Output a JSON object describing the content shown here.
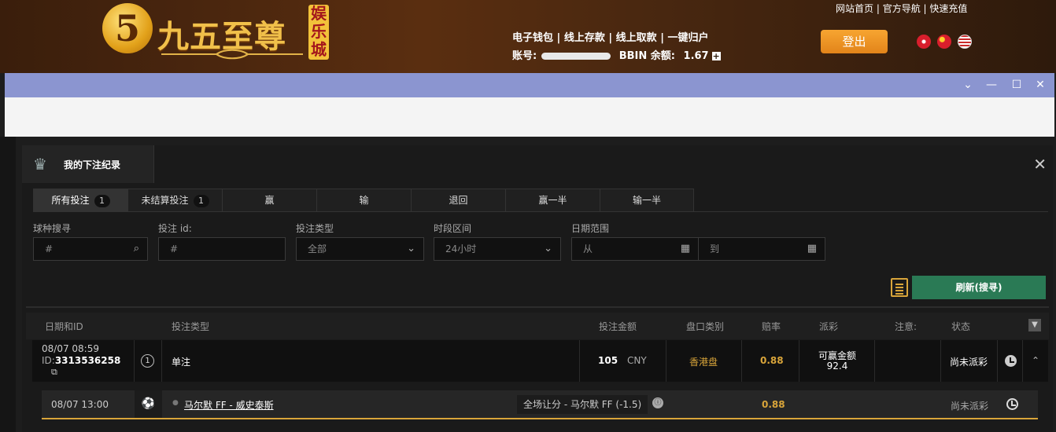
{
  "header": {
    "logo_numeral": "5",
    "logo_text": "九五至尊",
    "logo_seal": "娱乐城",
    "top_links": [
      "网站首页",
      "官方导航",
      "快速充值"
    ],
    "account_links": [
      "电子钱包",
      "线上存款",
      "线上取款",
      "一键归户"
    ],
    "account_label": "账号:",
    "balance_label": "BBIN 余额:",
    "balance_value": "1.67",
    "logout_label": "登出",
    "flags": [
      "hk-flag-icon",
      "cn-flag-icon",
      "us-flag-icon"
    ]
  },
  "window": {
    "controls": [
      "chevron-down-icon",
      "minimize-icon",
      "maximize-icon",
      "close-icon"
    ]
  },
  "panel": {
    "title": "我的下注纪录",
    "tabs": [
      {
        "label": "所有投注",
        "badge": "1"
      },
      {
        "label": "未结算投注",
        "badge": "1"
      },
      {
        "label": "赢",
        "badge": ""
      },
      {
        "label": "输",
        "badge": ""
      },
      {
        "label": "退回",
        "badge": ""
      },
      {
        "label": "赢一半",
        "badge": ""
      },
      {
        "label": "输一半",
        "badge": ""
      }
    ],
    "filters": {
      "sport_label": "球种搜寻",
      "sport_placeholder": "#",
      "betid_label": "投注 id:",
      "betid_placeholder": "#",
      "bettype_label": "投注类型",
      "bettype_value": "全部",
      "period_label": "时段区间",
      "period_value": "24小时",
      "daterange_label": "日期范围",
      "date_from": "从",
      "date_to": "到"
    },
    "refresh_label": "刷新(搜寻)",
    "columns": [
      "日期和ID",
      "投注类型",
      "投注金额",
      "盘口类别",
      "赔率",
      "派彩",
      "注意:",
      "状态"
    ],
    "bet": {
      "datetime": "08/07 08:59",
      "id_prefix": "ID:",
      "id": "3313536258",
      "count": "1",
      "type": "单注",
      "amount": "105",
      "currency": "CNY",
      "market": "香港盘",
      "odds": "0.88",
      "payout_label": "可赢金额",
      "payout_value": "92.4",
      "status": "尚未派彩"
    },
    "selection": {
      "datetime": "08/07 13:00",
      "match": "马尔默 FF - 威史泰斯",
      "pick": "全场让分 - 马尔默 FF (-1.5)",
      "odds": "0.88",
      "status": "尚未派彩"
    }
  },
  "colors": {
    "accent_gold": "#d9a53a",
    "refresh_green": "#2a7a55",
    "window_bar": "#8b95d0"
  }
}
